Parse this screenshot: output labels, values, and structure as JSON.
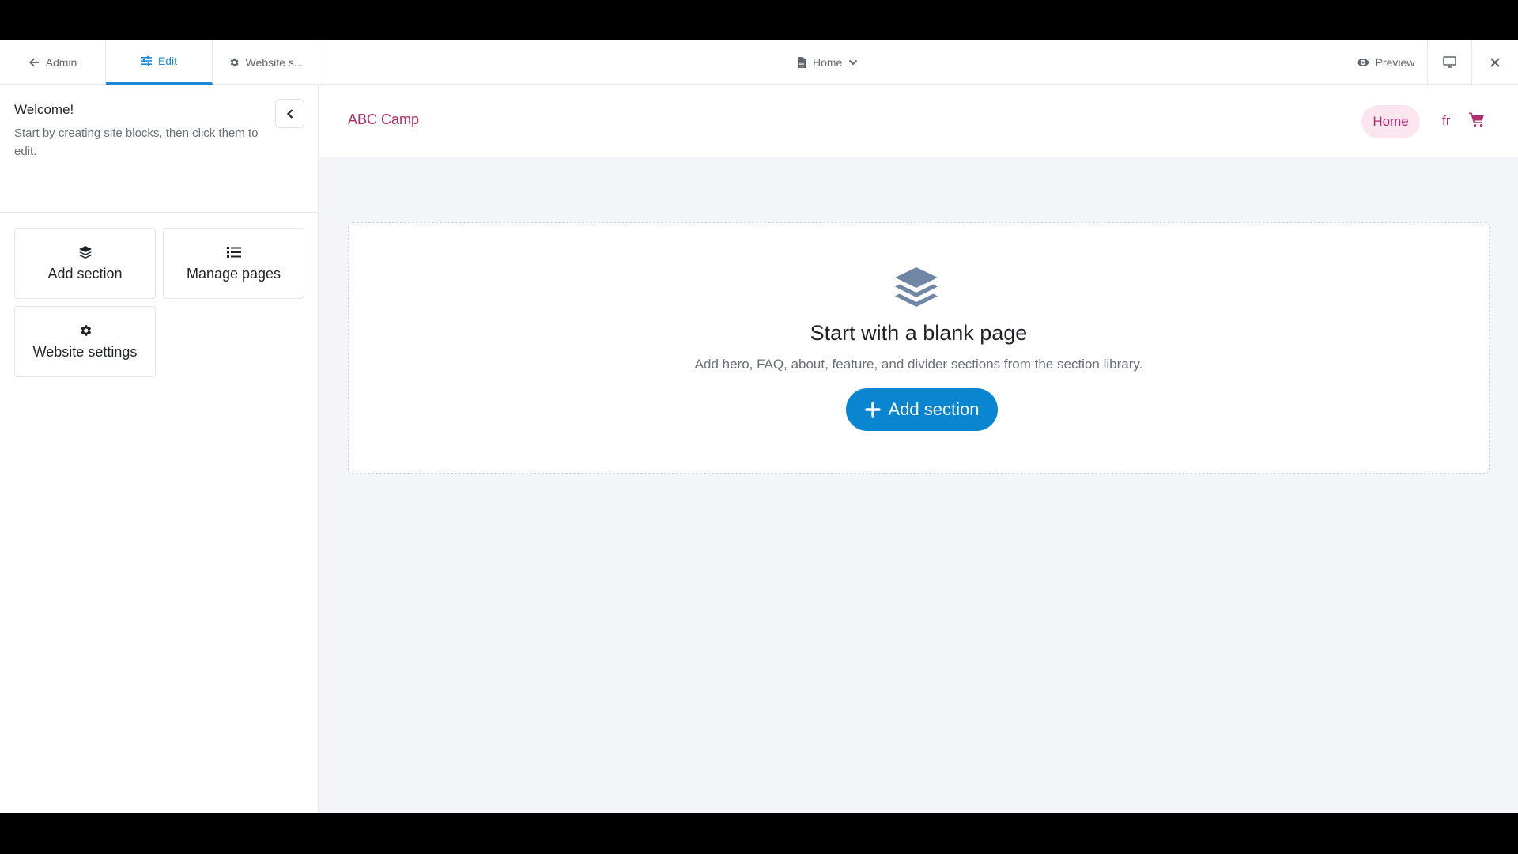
{
  "topbar": {
    "tabs": [
      {
        "label": "Admin",
        "icon": "arrow-left-icon"
      },
      {
        "label": "Edit",
        "icon": "sliders-icon"
      },
      {
        "label": "Website s...",
        "icon": "gear-icon"
      }
    ],
    "page_select": {
      "label": "Home",
      "icon": "file-icon"
    },
    "preview_label": "Preview"
  },
  "sidebar": {
    "welcome_title": "Welcome!",
    "welcome_text": "Start by creating site blocks, then click them to edit.",
    "cards": [
      {
        "label": "Add section",
        "icon": "layers-icon"
      },
      {
        "label": "Manage pages",
        "icon": "list-icon"
      },
      {
        "label": "Website settings",
        "icon": "gear-icon"
      }
    ]
  },
  "site": {
    "logo": "ABC Camp",
    "nav_home": "Home",
    "lang": "fr",
    "accent": "#b12e6f"
  },
  "blank": {
    "title": "Start with a blank page",
    "description": "Add hero, FAQ, about, feature, and divider sections from the section library.",
    "button": "Add section"
  },
  "colors": {
    "primary": "#0a86d0",
    "tab_active": "#1a8ad6"
  }
}
